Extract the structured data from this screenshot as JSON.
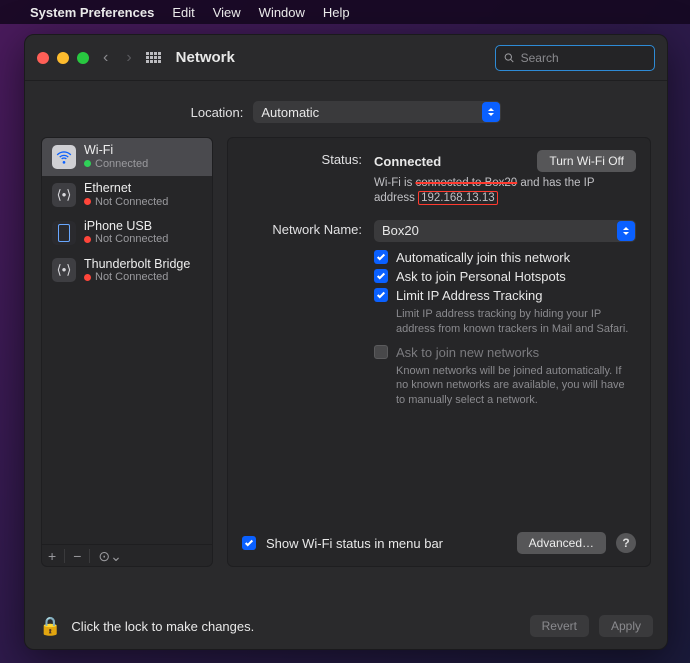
{
  "menubar": {
    "apple": "",
    "app": "System Preferences",
    "items": [
      "Edit",
      "View",
      "Window",
      "Help"
    ]
  },
  "toolbar": {
    "title": "Network",
    "search_placeholder": "Search"
  },
  "location": {
    "label": "Location:",
    "value": "Automatic"
  },
  "sidebar": {
    "items": [
      {
        "name": "Wi-Fi",
        "status": "Connected",
        "dot": "green",
        "icon": "wifi",
        "active": true
      },
      {
        "name": "Ethernet",
        "status": "Not Connected",
        "dot": "red",
        "icon": "ethernet",
        "active": false
      },
      {
        "name": "iPhone USB",
        "status": "Not Connected",
        "dot": "red",
        "icon": "iphone",
        "active": false
      },
      {
        "name": "Thunderbolt Bridge",
        "status": "Not Connected",
        "dot": "red",
        "icon": "thunderbolt",
        "active": false
      }
    ],
    "footer": {
      "plus": "+",
      "minus": "−",
      "menu": "⊙⌄"
    }
  },
  "detail": {
    "status_label": "Status:",
    "status_value": "Connected",
    "turn_off": "Turn Wi-Fi Off",
    "status_desc_1": "Wi-Fi is ",
    "status_desc_strike": "connected to Box20",
    "status_desc_2": " and has the IP address ",
    "ip": "192.168.13.13",
    "network_name_label": "Network Name:",
    "network_name_value": "Box20",
    "opt_autojoin": "Automatically join this network",
    "opt_hotspot": "Ask to join Personal Hotspots",
    "opt_limitip": "Limit IP Address Tracking",
    "limitip_desc": "Limit IP address tracking by hiding your IP address from known trackers in Mail and Safari.",
    "opt_askjoin": "Ask to join new networks",
    "askjoin_desc": "Known networks will be joined automatically. If no known networks are available, you will have to manually select a network.",
    "show_status": "Show Wi-Fi status in menu bar",
    "advanced": "Advanced…",
    "help": "?"
  },
  "bottom": {
    "lock_text": "Click the lock to make changes.",
    "revert": "Revert",
    "apply": "Apply"
  },
  "colors": {
    "accent": "#0a60ff",
    "red": "#ff3b30"
  }
}
